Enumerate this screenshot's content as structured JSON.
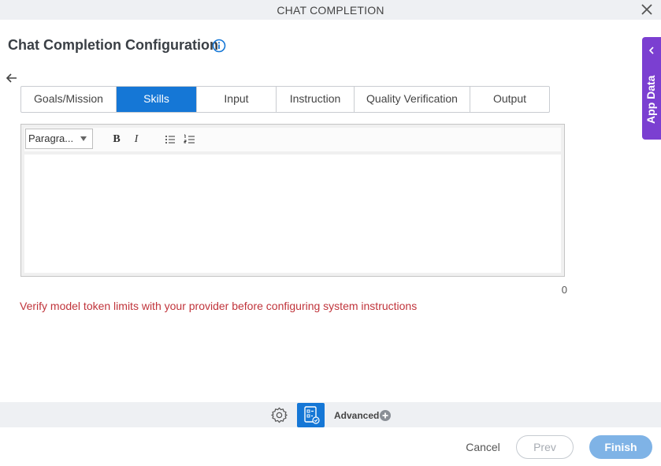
{
  "dialog": {
    "title": "CHAT COMPLETION"
  },
  "page": {
    "title": "Chat Completion Configuration"
  },
  "tabs": [
    {
      "label": "Goals/Mission",
      "active": false
    },
    {
      "label": "Skills",
      "active": true
    },
    {
      "label": "Input",
      "active": false
    },
    {
      "label": "Instruction",
      "active": false
    },
    {
      "label": "Quality Verification",
      "active": false
    },
    {
      "label": "Output",
      "active": false
    }
  ],
  "editor": {
    "format_select": "Paragra...",
    "bold_label": "B",
    "italic_label": "I",
    "content": "",
    "char_count": "0"
  },
  "warning": "Verify model token limits with your provider before configuring system instructions",
  "footer": {
    "advanced_label": "Advanced"
  },
  "buttons": {
    "cancel": "Cancel",
    "prev": "Prev",
    "finish": "Finish"
  },
  "side_panel": {
    "label": "App Data"
  },
  "colors": {
    "accent": "#1577d6",
    "side_panel": "#7b3fd1",
    "warning": "#c0343b",
    "finish_disabled": "#7fb3e6"
  },
  "icons": [
    "close-icon",
    "info-icon",
    "back-arrow-icon",
    "bulleted-list-icon",
    "numbered-list-icon",
    "settings-gear-icon",
    "app-data-icon",
    "plus-circle-icon",
    "chevron-left-icon"
  ]
}
